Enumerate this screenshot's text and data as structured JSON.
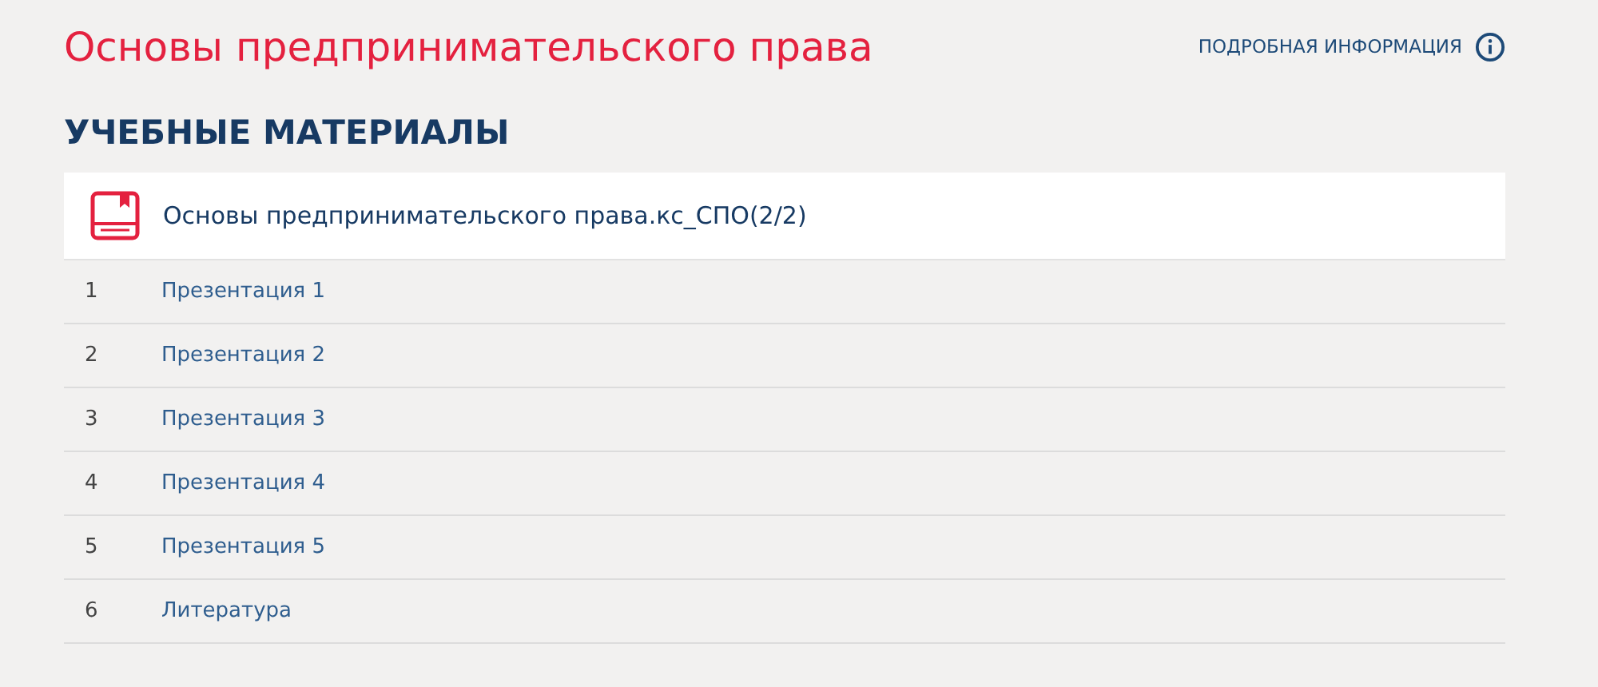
{
  "page_title": "Основы предпринимательского права",
  "info_link": {
    "label": "ПОДРОБНАЯ ИНФОРМАЦИЯ"
  },
  "section_title": "УЧЕБНЫЕ МАТЕРИАЛЫ",
  "course": {
    "title": "Основы предпринимательского права.кс_СПО(2/2)"
  },
  "materials": [
    {
      "number": "1",
      "title": "Презентация 1"
    },
    {
      "number": "2",
      "title": "Презентация 2"
    },
    {
      "number": "3",
      "title": "Презентация 3"
    },
    {
      "number": "4",
      "title": "Презентация 4"
    },
    {
      "number": "5",
      "title": "Презентация 5"
    },
    {
      "number": "6",
      "title": "Литература"
    }
  ]
}
